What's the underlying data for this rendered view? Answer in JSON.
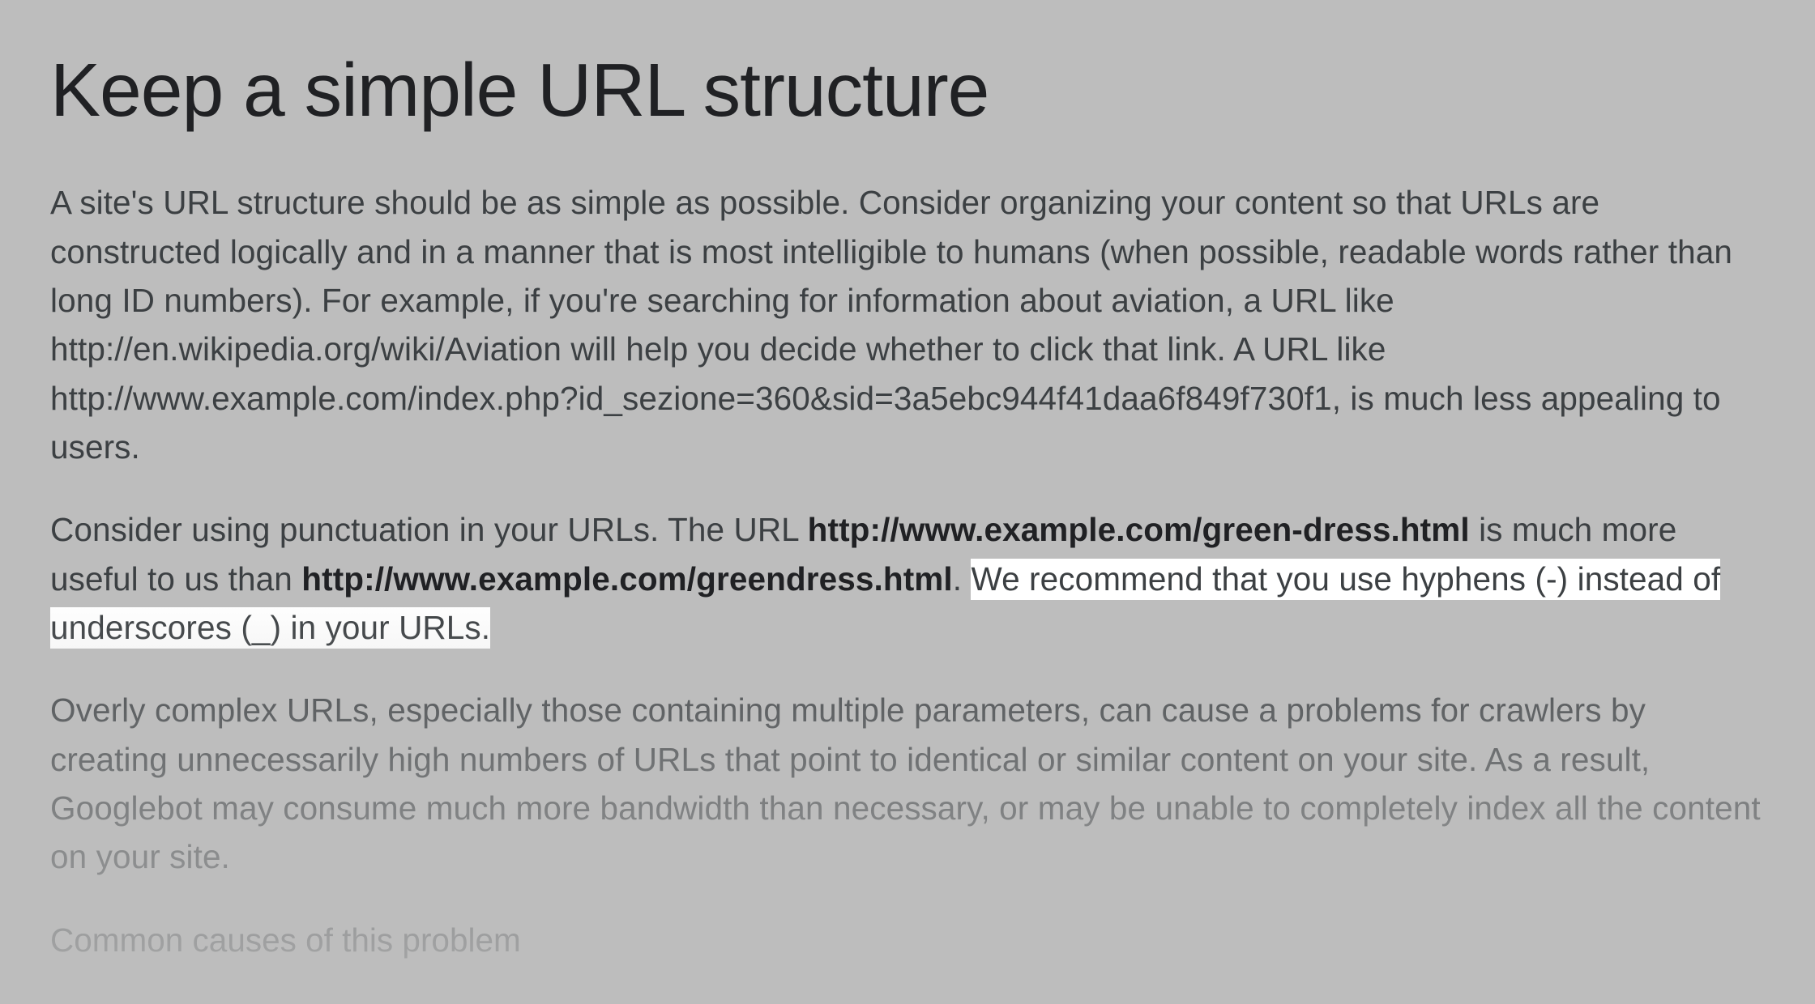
{
  "article": {
    "title": "Keep a simple URL structure",
    "p1": "A site's URL structure should be as simple as possible. Consider organizing your content so that URLs are constructed logically and in a manner that is most intelligible to humans (when possible, readable words rather than long ID numbers). For example, if you're searching for information about aviation, a URL like http://en.wikipedia.org/wiki/Aviation will help you decide whether to click that link. A URL like http://www.example.com/index.php?id_sezione=360&sid=3a5ebc944f41daa6f849f730f1, is much less appealing to users.",
    "p2": {
      "seg1": "Consider using punctuation in your URLs. The URL ",
      "bold1": "http://www.example.com/green-dress.html",
      "seg2": " is much more useful to us than ",
      "bold2": "http://www.example.com/greendress.html",
      "seg3": ". ",
      "highlight": "We recommend that you use hyphens (-) instead of underscores (_) in your URLs."
    },
    "p3": "Overly complex URLs, especially those containing multiple parameters, can cause a problems for crawlers by creating unnecessarily high numbers of URLs that point to identical or similar content on your site. As a result, Googlebot may consume much more bandwidth than necessary, or may be unable to completely index all the content on your site.",
    "subhead": "Common causes of this problem"
  }
}
